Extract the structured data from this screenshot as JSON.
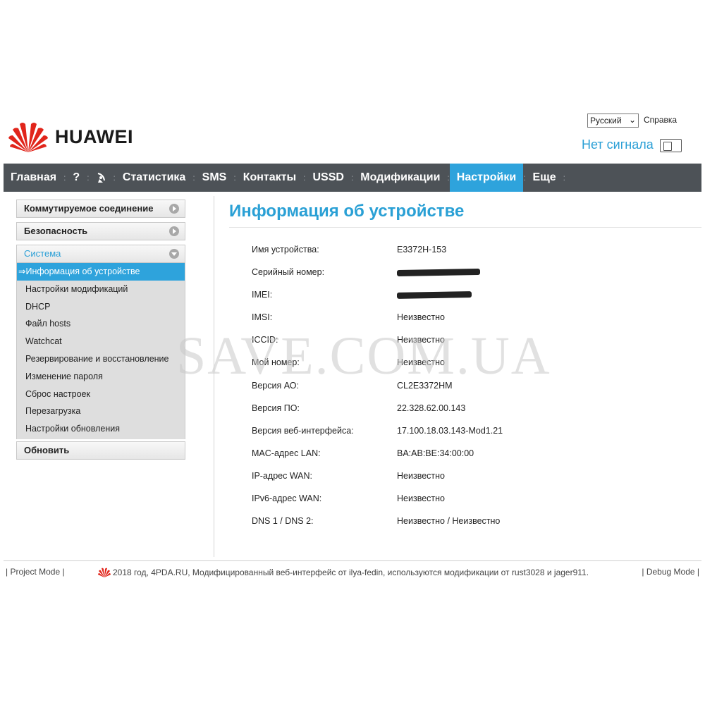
{
  "header": {
    "brand": "HUAWEI",
    "language": "Русский",
    "help": "Справка",
    "signal_status": "Нет сигнала"
  },
  "nav": {
    "items": [
      {
        "label": "Главная",
        "active": false
      },
      {
        "label": "?",
        "active": false
      },
      {
        "label": "Статистика",
        "active": false
      },
      {
        "label": "SMS",
        "active": false
      },
      {
        "label": "Контакты",
        "active": false
      },
      {
        "label": "USSD",
        "active": false
      },
      {
        "label": "Модификации",
        "active": false
      },
      {
        "label": "Настройки",
        "active": true
      },
      {
        "label": "Еще",
        "active": false
      }
    ],
    "active_color": "#2ea3dc"
  },
  "sidebar": {
    "sections": [
      {
        "label": "Коммутируемое соединение",
        "expanded": false
      },
      {
        "label": "Безопасность",
        "expanded": false
      },
      {
        "label": "Система",
        "expanded": true
      }
    ],
    "system_items": [
      {
        "label": "⇒Информация об устройстве",
        "active": true
      },
      {
        "label": "Настройки модификаций",
        "active": false
      },
      {
        "label": "DHCP",
        "active": false
      },
      {
        "label": "Файл hosts",
        "active": false
      },
      {
        "label": "Watchcat",
        "active": false
      },
      {
        "label": "Резервирование и восстановление",
        "active": false
      },
      {
        "label": "Изменение пароля",
        "active": false
      },
      {
        "label": "Сброс настроек",
        "active": false
      },
      {
        "label": "Перезагрузка",
        "active": false
      },
      {
        "label": "Настройки обновления",
        "active": false
      }
    ],
    "update_label": "Обновить"
  },
  "main": {
    "title": "Информация об устройстве",
    "rows": [
      {
        "label": "Имя устройства:",
        "value": "E3372H-153"
      },
      {
        "label": "Серийный номер:",
        "value": ""
      },
      {
        "label": "IMEI:",
        "value": ""
      },
      {
        "label": "IMSI:",
        "value": "Неизвестно"
      },
      {
        "label": "ICCID:",
        "value": "Неизвестно"
      },
      {
        "label": "Мой номер:",
        "value": "Неизвестно"
      },
      {
        "label": "Версия АО:",
        "value": "CL2E3372HM"
      },
      {
        "label": "Версия ПО:",
        "value": "22.328.62.00.143"
      },
      {
        "label": "Версия веб-интерфейса:",
        "value": "17.100.18.03.143-Mod1.21"
      },
      {
        "label": "MAC-адрес LAN:",
        "value": "BA:AB:BE:34:00:00"
      },
      {
        "label": "IP-адрес WAN:",
        "value": "Неизвестно"
      },
      {
        "label": "IPv6-адрес WAN:",
        "value": "Неизвестно"
      },
      {
        "label": "DNS 1 / DNS 2:",
        "value": "Неизвестно / Неизвестно"
      }
    ]
  },
  "footer": {
    "project_mode": "| Project Mode |",
    "debug_mode": "| Debug Mode |",
    "copyright": "2018 год, 4PDA.RU, Модифицированный веб-интерфейс от ilya-fedin, используются модификации от rust3028 и jager911."
  },
  "watermark": "SAVE.COM.UA",
  "colors": {
    "accent": "#2aa0d5",
    "nav_bg": "#4d5257",
    "brand_red": "#e1251b"
  }
}
